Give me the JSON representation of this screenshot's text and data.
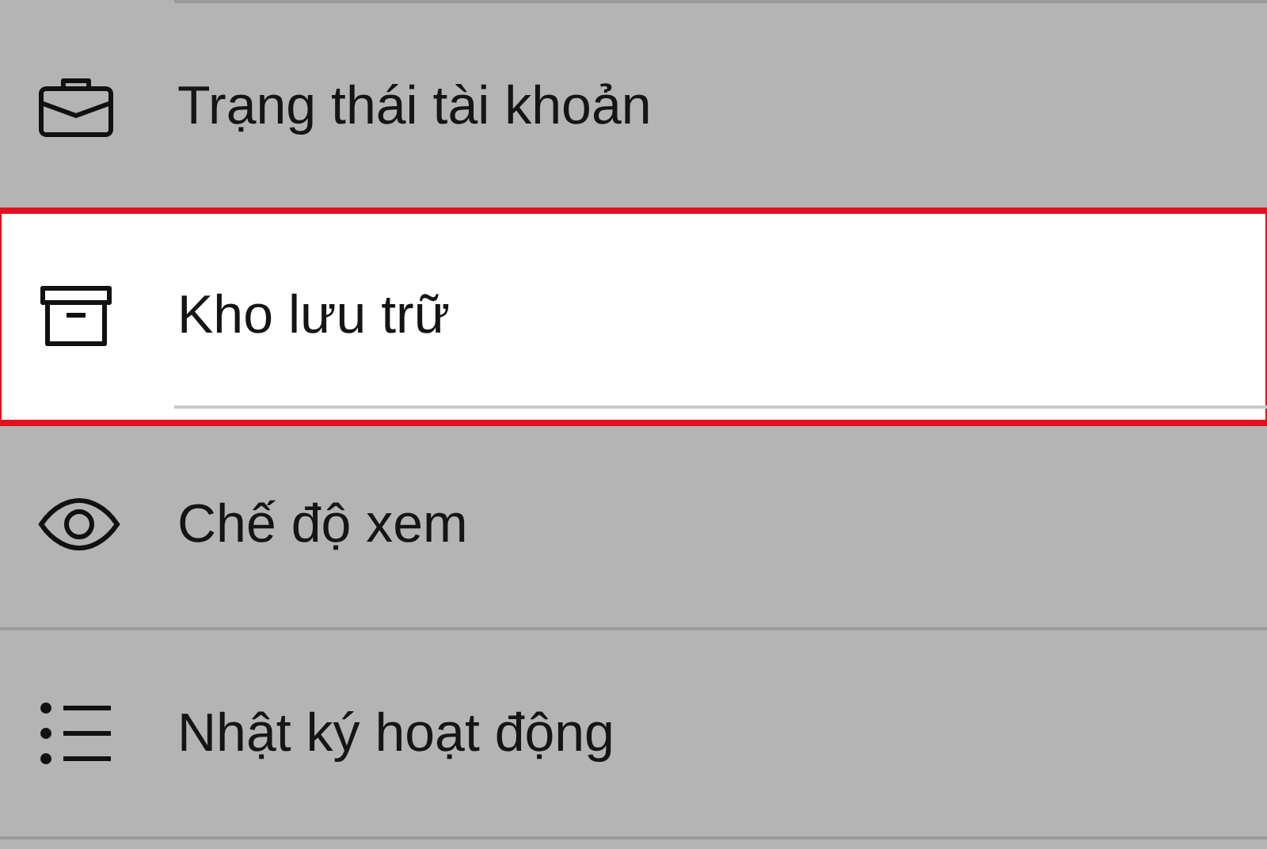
{
  "menu": {
    "items": [
      {
        "kind": "briefcase",
        "label": "Trạng thái tài khoản",
        "selected": false
      },
      {
        "kind": "archive",
        "label": "Kho lưu trữ",
        "selected": true
      },
      {
        "kind": "eye",
        "label": "Chế độ xem",
        "selected": false
      },
      {
        "kind": "list",
        "label": "Nhật ký hoạt động",
        "selected": false
      }
    ]
  }
}
